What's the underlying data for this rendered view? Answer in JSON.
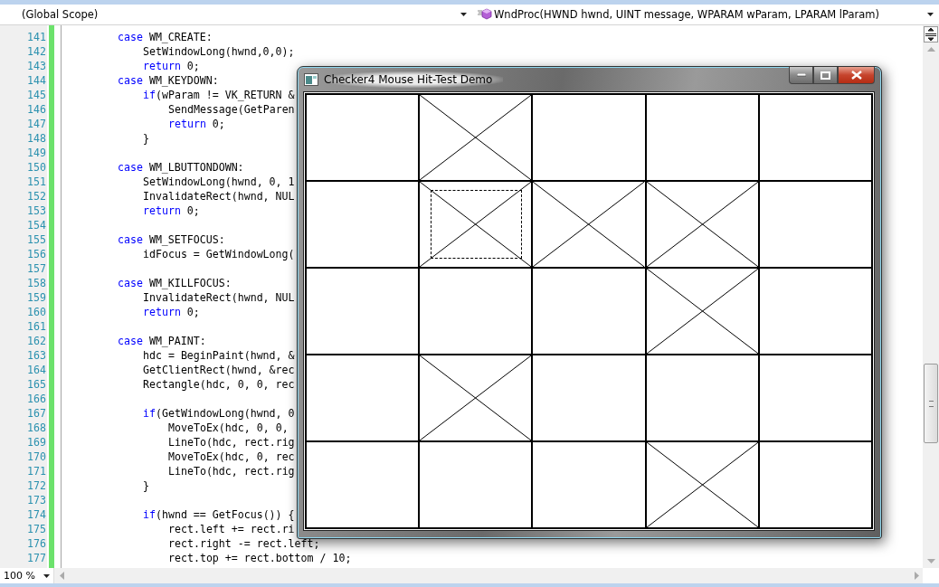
{
  "navigation_bar": {
    "scope": "(Global Scope)",
    "member": "WndProc(HWND hwnd, UINT message, WPARAM wParam, LPARAM lParam)"
  },
  "code_lines": [
    {
      "number": "141",
      "segments": [
        {
          "kind": "keyword",
          "text": "case"
        },
        {
          "kind": "plain",
          "text": " WM_CREATE:"
        }
      ],
      "children": [
        {
          "number": "142",
          "segments": [
            {
              "kind": "plain",
              "text": "SetWindowLong(hwnd,0,0);"
            }
          ]
        },
        {
          "number": "143",
          "segments": [
            {
              "kind": "keyword",
              "text": "return"
            },
            {
              "kind": "plain",
              "text": " 0;"
            }
          ]
        }
      ]
    },
    {
      "number": "144",
      "segments": [
        {
          "kind": "keyword",
          "text": "case"
        },
        {
          "kind": "plain",
          "text": " WM_KEYDOWN:"
        }
      ],
      "children": [
        {
          "number": "145",
          "segments": [
            {
              "kind": "keyword",
              "text": "if"
            },
            {
              "kind": "plain",
              "text": "(wParam != VK_RETURN &"
            }
          ],
          "children": [
            {
              "number": "146",
              "segments": [
                {
                  "kind": "plain",
                  "text": "SendMessage(GetParen"
                }
              ]
            },
            {
              "number": "147",
              "segments": [
                {
                  "kind": "keyword",
                  "text": "return"
                },
                {
                  "kind": "plain",
                  "text": " 0;"
                }
              ]
            }
          ]
        },
        {
          "number": "148",
          "segments": [
            {
              "kind": "plain",
              "text": "}"
            }
          ]
        }
      ]
    },
    {
      "number": "149"
    },
    {
      "number": "150",
      "segments": [
        {
          "kind": "keyword",
          "text": "case"
        },
        {
          "kind": "plain",
          "text": " WM_LBUTTONDOWN:"
        }
      ],
      "children": [
        {
          "number": "151",
          "segments": [
            {
              "kind": "plain",
              "text": "SetWindowLong(hwnd, 0, 1"
            }
          ]
        },
        {
          "number": "152",
          "segments": [
            {
              "kind": "plain",
              "text": "InvalidateRect(hwnd, NUL"
            }
          ]
        },
        {
          "number": "153",
          "segments": [
            {
              "kind": "keyword",
              "text": "return"
            },
            {
              "kind": "plain",
              "text": " 0;"
            }
          ]
        }
      ]
    },
    {
      "number": "154"
    },
    {
      "number": "155",
      "segments": [
        {
          "kind": "keyword",
          "text": "case"
        },
        {
          "kind": "plain",
          "text": " WM_SETFOCUS:"
        }
      ],
      "children": [
        {
          "number": "156",
          "segments": [
            {
              "kind": "plain",
              "text": "idFocus = GetWindowLong("
            }
          ]
        }
      ]
    },
    {
      "number": "157"
    },
    {
      "number": "158",
      "segments": [
        {
          "kind": "keyword",
          "text": "case"
        },
        {
          "kind": "plain",
          "text": " WM_KILLFOCUS:"
        }
      ],
      "children": [
        {
          "number": "159",
          "segments": [
            {
              "kind": "plain",
              "text": "InvalidateRect(hwnd, NUL"
            }
          ]
        },
        {
          "number": "160",
          "segments": [
            {
              "kind": "keyword",
              "text": "return"
            },
            {
              "kind": "plain",
              "text": " 0;"
            }
          ]
        }
      ]
    },
    {
      "number": "161"
    },
    {
      "number": "162",
      "segments": [
        {
          "kind": "keyword",
          "text": "case"
        },
        {
          "kind": "plain",
          "text": " WM_PAINT:"
        }
      ],
      "children": [
        {
          "number": "163",
          "segments": [
            {
              "kind": "plain",
              "text": "hdc = BeginPaint(hwnd, &"
            }
          ]
        },
        {
          "number": "164",
          "segments": [
            {
              "kind": "plain",
              "text": "GetClientRect(hwnd, &rec"
            }
          ]
        },
        {
          "number": "165",
          "segments": [
            {
              "kind": "plain",
              "text": "Rectangle(hdc, 0, 0, rec"
            }
          ]
        },
        {
          "number": "166"
        },
        {
          "number": "167",
          "segments": [
            {
              "kind": "keyword",
              "text": "if"
            },
            {
              "kind": "plain",
              "text": "(GetWindowLong(hwnd, 0"
            }
          ],
          "children": [
            {
              "number": "168",
              "segments": [
                {
                  "kind": "plain",
                  "text": "MoveToEx(hdc, 0, 0,"
                }
              ]
            },
            {
              "number": "169",
              "segments": [
                {
                  "kind": "plain",
                  "text": "LineTo(hdc, rect.rig"
                }
              ]
            },
            {
              "number": "170",
              "segments": [
                {
                  "kind": "plain",
                  "text": "MoveToEx(hdc, 0, rec"
                }
              ]
            },
            {
              "number": "171",
              "segments": [
                {
                  "kind": "plain",
                  "text": "LineTo(hdc, rect.rig"
                }
              ]
            }
          ]
        },
        {
          "number": "172",
          "segments": [
            {
              "kind": "plain",
              "text": "}"
            }
          ]
        },
        {
          "number": "173"
        },
        {
          "number": "174",
          "segments": [
            {
              "kind": "keyword",
              "text": "if"
            },
            {
              "kind": "plain",
              "text": "(hwnd == GetFocus()) {"
            }
          ],
          "children": [
            {
              "number": "175",
              "segments": [
                {
                  "kind": "plain",
                  "text": "rect.left += rect.ri"
                }
              ]
            },
            {
              "number": "176",
              "segments": [
                {
                  "kind": "plain",
                  "text": "rect.right -= rect.left;"
                }
              ]
            },
            {
              "number": "177",
              "segments": [
                {
                  "kind": "plain",
                  "text": "rect.top += rect.bottom / 10;"
                }
              ]
            }
          ]
        }
      ]
    }
  ],
  "window": {
    "title": "Checker4 Mouse Hit-Test Demo",
    "rows": [
      [
        {
          "checked": false,
          "focused": false
        },
        {
          "checked": true,
          "focused": false
        },
        {
          "checked": false,
          "focused": false
        },
        {
          "checked": false,
          "focused": false
        },
        {
          "checked": false,
          "focused": false
        }
      ],
      [
        {
          "checked": false,
          "focused": false
        },
        {
          "checked": true,
          "focused": true
        },
        {
          "checked": true,
          "focused": false
        },
        {
          "checked": true,
          "focused": false
        },
        {
          "checked": false,
          "focused": false
        }
      ],
      [
        {
          "checked": false,
          "focused": false
        },
        {
          "checked": false,
          "focused": false
        },
        {
          "checked": false,
          "focused": false
        },
        {
          "checked": true,
          "focused": false
        },
        {
          "checked": false,
          "focused": false
        }
      ],
      [
        {
          "checked": false,
          "focused": false
        },
        {
          "checked": true,
          "focused": false
        },
        {
          "checked": false,
          "focused": false
        },
        {
          "checked": false,
          "focused": false
        },
        {
          "checked": false,
          "focused": false
        }
      ],
      [
        {
          "checked": false,
          "focused": false
        },
        {
          "checked": false,
          "focused": false
        },
        {
          "checked": false,
          "focused": false
        },
        {
          "checked": true,
          "focused": false
        },
        {
          "checked": false,
          "focused": false
        }
      ]
    ]
  },
  "status_bar": {
    "zoom": "100 %"
  }
}
